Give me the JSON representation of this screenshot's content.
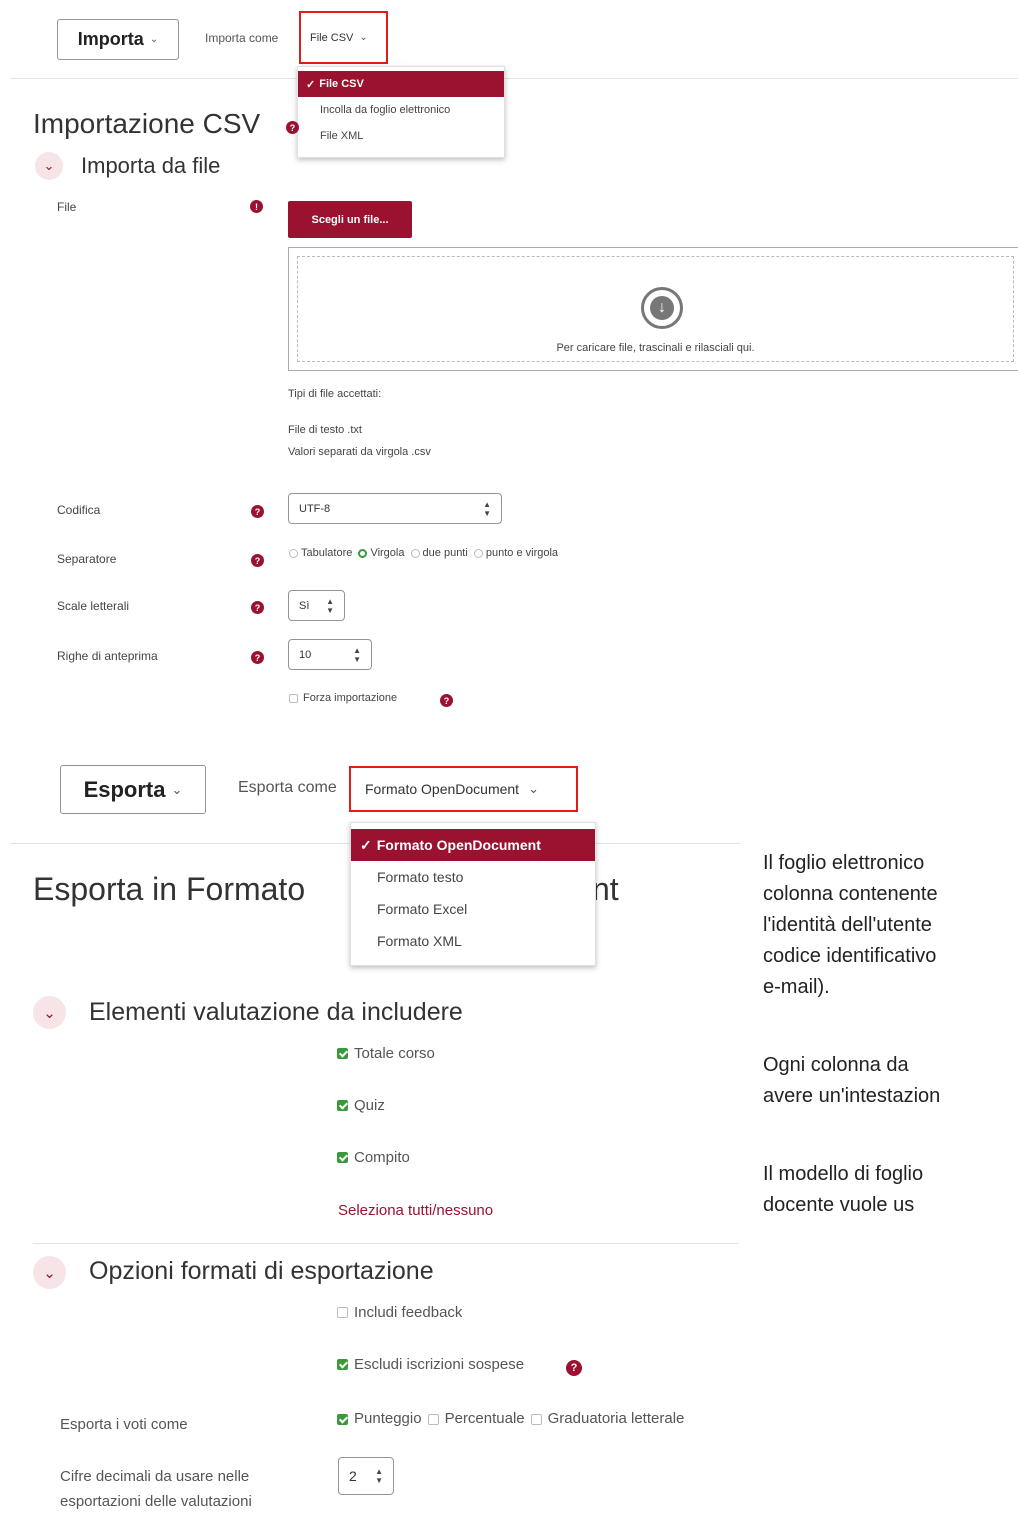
{
  "import_section": {
    "button_label": "Importa",
    "import_as_label": "Importa come",
    "selected_format": "File CSV",
    "dropdown_options": [
      "File CSV",
      "Incolla da foglio elettronico",
      "File XML"
    ],
    "page_title": "Importazione CSV",
    "collapse_title": "Importa da file",
    "file_label": "File",
    "choose_file_button": "Scegli un file...",
    "dropzone_text": "Per caricare file, trascinali e rilasciali qui.",
    "accepted_types_label": "Tipi di file accettati:",
    "accepted_types": [
      "File di testo .txt",
      "Valori separati da virgola .csv"
    ],
    "encoding_label": "Codifica",
    "encoding_value": "UTF-8",
    "separator_label": "Separatore",
    "separator_options": [
      "Tabulatore",
      "Virgola",
      "due punti",
      "punto e virgola"
    ],
    "separator_selected": "Virgola",
    "letter_scales_label": "Scale letterali",
    "letter_scales_value": "Sì",
    "preview_rows_label": "Righe di anteprima",
    "preview_rows_value": "10",
    "force_import_label": "Forza importazione"
  },
  "export_section": {
    "button_label": "Esporta",
    "export_as_label": "Esporta come",
    "selected_format": "Formato OpenDocument",
    "dropdown_options": [
      "Formato OpenDocument",
      "Formato testo",
      "Formato Excel",
      "Formato XML"
    ],
    "page_title_left": "Esporta in Formato",
    "page_title_right": "nt",
    "grade_items_title": "Elementi valutazione da includere",
    "grade_items": [
      {
        "label": "Totale corso",
        "checked": true
      },
      {
        "label": "Quiz",
        "checked": true
      },
      {
        "label": "Compito",
        "checked": true
      }
    ],
    "select_all_link": "Seleziona tutti/nessuno",
    "format_options_title": "Opzioni formati di esportazione",
    "include_feedback_label": "Includi feedback",
    "exclude_suspended_label": "Escludi iscrizioni sospese",
    "export_grades_as_label": "Esporta i voti come",
    "export_grade_options": [
      {
        "label": "Punteggio",
        "checked": true
      },
      {
        "label": "Percentuale",
        "checked": false
      },
      {
        "label": "Graduatoria letterale",
        "checked": false
      }
    ],
    "decimals_label_line1": "Cifre decimali da usare nelle",
    "decimals_label_line2": "esportazioni delle valutazioni",
    "decimals_value": "2"
  },
  "side_text": {
    "lines": [
      "Il foglio elettronico",
      "colonna contenente",
      "l'identità dell'utente",
      "codice identificativo",
      "e-mail).",
      "Ogni colonna da",
      "avere un'intestazion",
      "Il modello di foglio",
      "docente vuole us"
    ]
  },
  "colors": {
    "accent": "#9a1230",
    "highlight_box": "#e21b1b",
    "checkbox_green": "#3a9a3a"
  },
  "icons": {
    "chevron": "chevron-down-icon",
    "help": "question-circle-icon",
    "download": "download-circle-icon",
    "check": "check-icon"
  }
}
